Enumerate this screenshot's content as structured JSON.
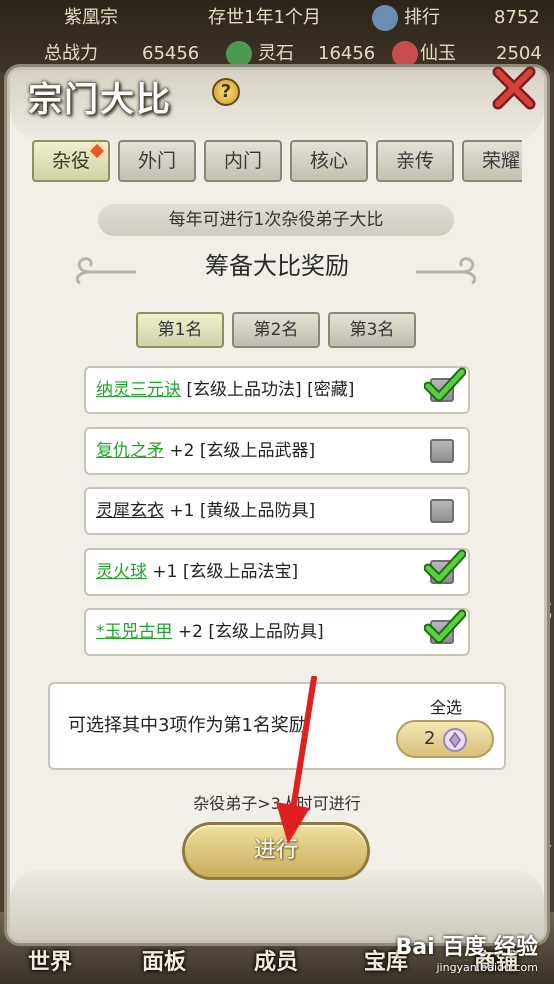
{
  "hud": {
    "sect_name": "紫凰宗",
    "existence": "存世1年1个月",
    "rank_label": "排行",
    "rank_value": "8752",
    "power_label": "总战力",
    "power_value": "65456",
    "stone_label": "灵石",
    "stone_value": "16456",
    "jade_label": "仙玉",
    "jade_value": "2504"
  },
  "side_right": {
    "glyph1": "武",
    "glyph2": "议"
  },
  "modal": {
    "title": "宗门大比",
    "help_glyph": "?",
    "tabs": [
      {
        "label": "杂役",
        "active": true
      },
      {
        "label": "外门",
        "active": false
      },
      {
        "label": "内门",
        "active": false
      },
      {
        "label": "核心",
        "active": false
      },
      {
        "label": "亲传",
        "active": false
      },
      {
        "label": "荣耀",
        "active": false
      }
    ],
    "info": "每年可进行1次杂役弟子大比",
    "reward_title": "筹备大比奖励",
    "ranks": [
      {
        "label": "第1名",
        "active": true
      },
      {
        "label": "第2名",
        "active": false
      },
      {
        "label": "第3名",
        "active": false
      }
    ],
    "items": [
      {
        "name": "纳灵三元诀",
        "suffix": " [玄级上品功法] [密藏]",
        "green": true,
        "checked": true
      },
      {
        "name": "复仇之矛",
        "suffix": " +2 [玄级上品武器]",
        "green": true,
        "checked": false
      },
      {
        "name": "灵犀玄衣",
        "suffix": " +1 [黄级上品防具]",
        "green": false,
        "checked": false
      },
      {
        "name": "灵火球",
        "suffix": " +1 [玄级上品法宝]",
        "green": true,
        "checked": true
      },
      {
        "name": "*玉兕古甲",
        "suffix": " +2 [玄级上品防具]",
        "green": true,
        "checked": true
      }
    ],
    "select_text": "可选择其中3项作为第1名奖励",
    "select_all_label": "全选",
    "select_all_count": "2",
    "requirement": "杂役弟子>3人时可进行",
    "go_label": "进行"
  },
  "nav": {
    "world": "世界",
    "panel": "面板",
    "members": "成员",
    "treasury": "宝库",
    "shop": "商铺"
  },
  "watermark": {
    "logo": "Bai 百度 经验",
    "url": "jingyan.baidu.com"
  },
  "colors": {
    "accent_green": "#22a32b",
    "check_green": "#3bbf2a",
    "arrow_red": "#e02020",
    "gold": "#c9ad5a"
  }
}
